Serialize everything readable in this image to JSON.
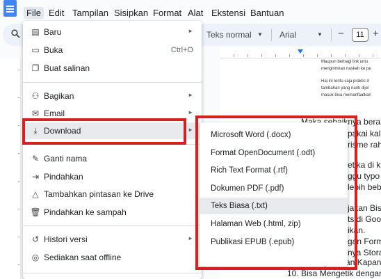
{
  "menubar": {
    "items": [
      "File",
      "Edit",
      "Tampilan",
      "Sisipkan",
      "Format",
      "Alat",
      "Ekstensi",
      "Bantuan"
    ]
  },
  "toolbar": {
    "style": "Teks normal",
    "font": "Arial",
    "minus": "−",
    "size": "11",
    "plus": "+"
  },
  "file_menu": {
    "items": [
      {
        "label": "Baru",
        "icon": "new-doc-icon",
        "arrow": true
      },
      {
        "label": "Buka",
        "icon": "folder-icon",
        "shortcut": "Ctrl+O"
      },
      {
        "label": "Buat salinan",
        "icon": "copy-icon"
      },
      {
        "label": "Bagikan",
        "icon": "share-person-icon",
        "arrow": true
      },
      {
        "label": "Email",
        "icon": "email-icon",
        "arrow": true
      },
      {
        "label": "Download",
        "icon": "download-icon",
        "arrow": true
      },
      {
        "label": "Ganti nama",
        "icon": "rename-icon"
      },
      {
        "label": "Pindahkan",
        "icon": "move-folder-icon"
      },
      {
        "label": "Tambahkan pintasan ke Drive",
        "icon": "drive-shortcut-icon"
      },
      {
        "label": "Pindahkan ke sampah",
        "icon": "trash-icon"
      },
      {
        "label": "Histori versi",
        "icon": "history-icon",
        "arrow": true
      },
      {
        "label": "Sediakan saat offline",
        "icon": "offline-icon"
      }
    ]
  },
  "download_submenu": {
    "items": [
      "Microsoft Word (.docx)",
      "Format OpenDocument (.odt)",
      "Rich Text Format (.rtf)",
      "Dokumen PDF (.pdf)",
      "Teks Biasa (.txt)",
      "Halaman Web (.html, zip)",
      "Publikasi EPUB (.epub)"
    ]
  },
  "document": {
    "notes": [
      "Maupun berbagi link untu",
      "mengirimkan naskah ke pe",
      "Hai ini tentu saja praktis d",
      "tambahan yang nanti dijel",
      "masuk bisa memanfaatkan"
    ],
    "lines": [
      "Maka sebaiknya beral",
      "pakai kali a",
      "risme rah",
      "etika di kli",
      "ggu typo",
      "lebih beb",
      "jakan Bisa",
      "ts di Goog",
      "ikan.",
      "gan Forma",
      "nya Storag",
      "9.   Bisa Digunakan Kapan",
      "10. Bisa Mengetik dengan"
    ]
  }
}
